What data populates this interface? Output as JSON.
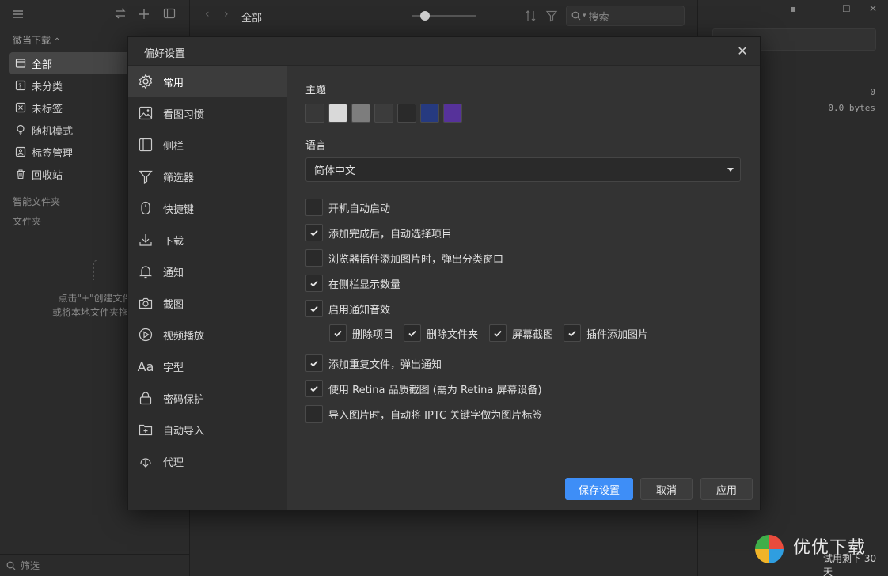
{
  "sidebar": {
    "library_name": "微当下载",
    "items": [
      {
        "label": "全部",
        "icon": "all-items-icon"
      },
      {
        "label": "未分类",
        "icon": "uncategorized-icon"
      },
      {
        "label": "未标签",
        "icon": "untagged-icon"
      },
      {
        "label": "随机模式",
        "icon": "random-mode-icon"
      },
      {
        "label": "标签管理",
        "icon": "tag-manage-icon"
      },
      {
        "label": "回收站",
        "icon": "trash-icon"
      }
    ],
    "smart_folders_label": "智能文件夹",
    "folders_label": "文件夹",
    "hint_line1": "点击\"+\"创建文件",
    "hint_line2": "或将本地文件夹拖放",
    "filter_placeholder": "筛选"
  },
  "toolbar": {
    "breadcrumb": "全部",
    "search_placeholder": "搜索",
    "zoom_level": 0.2
  },
  "inspector": {
    "count": "0",
    "size": "0.0 bytes"
  },
  "modal": {
    "title": "偏好设置",
    "nav": [
      {
        "label": "常用",
        "icon": "gear-icon"
      },
      {
        "label": "看图习惯",
        "icon": "image-icon"
      },
      {
        "label": "侧栏",
        "icon": "sidebar-icon"
      },
      {
        "label": "筛选器",
        "icon": "filter-icon"
      },
      {
        "label": "快捷键",
        "icon": "mouse-icon"
      },
      {
        "label": "下载",
        "icon": "download-icon"
      },
      {
        "label": "通知",
        "icon": "bell-icon"
      },
      {
        "label": "截图",
        "icon": "camera-icon"
      },
      {
        "label": "视频播放",
        "icon": "play-icon"
      },
      {
        "label": "字型",
        "icon": "font-icon"
      },
      {
        "label": "密码保护",
        "icon": "lock-icon"
      },
      {
        "label": "自动导入",
        "icon": "folder-add-icon"
      },
      {
        "label": "代理",
        "icon": "proxy-icon"
      }
    ],
    "theme_label": "主题",
    "theme_colors": [
      "#383838",
      "#d9d9d9",
      "#7d7d7d",
      "#3c3c3c",
      "#2a2a2a",
      "#263a80",
      "#56329a"
    ],
    "language_label": "语言",
    "language_value": "简体中文",
    "options": [
      {
        "label": "开机自动启动",
        "checked": false
      },
      {
        "label": "添加完成后，自动选择项目",
        "checked": true
      },
      {
        "label": "浏览器插件添加图片时，弹出分类窗口",
        "checked": false
      },
      {
        "label": "在侧栏显示数量",
        "checked": true
      },
      {
        "label": "启用通知音效",
        "checked": true
      }
    ],
    "sub_options": [
      {
        "label": "删除项目",
        "checked": true
      },
      {
        "label": "删除文件夹",
        "checked": true
      },
      {
        "label": "屏幕截图",
        "checked": true
      },
      {
        "label": "插件添加图片",
        "checked": true
      }
    ],
    "options2": [
      {
        "label": "添加重复文件，弹出通知",
        "checked": true
      },
      {
        "label": "使用 Retina 品质截图 (需为 Retina 屏幕设备)",
        "checked": true
      },
      {
        "label": "导入图片时，自动将 IPTC 关键字做为图片标签",
        "checked": false
      }
    ],
    "buttons": {
      "save": "保存设置",
      "cancel": "取消",
      "apply": "应用"
    }
  },
  "footer": {
    "trial": "试用剩下 30 天",
    "brand": "优优下载"
  },
  "colors": {
    "accent": "#3e8ef7",
    "bg": "#2a2a2a",
    "panel": "#333333"
  }
}
